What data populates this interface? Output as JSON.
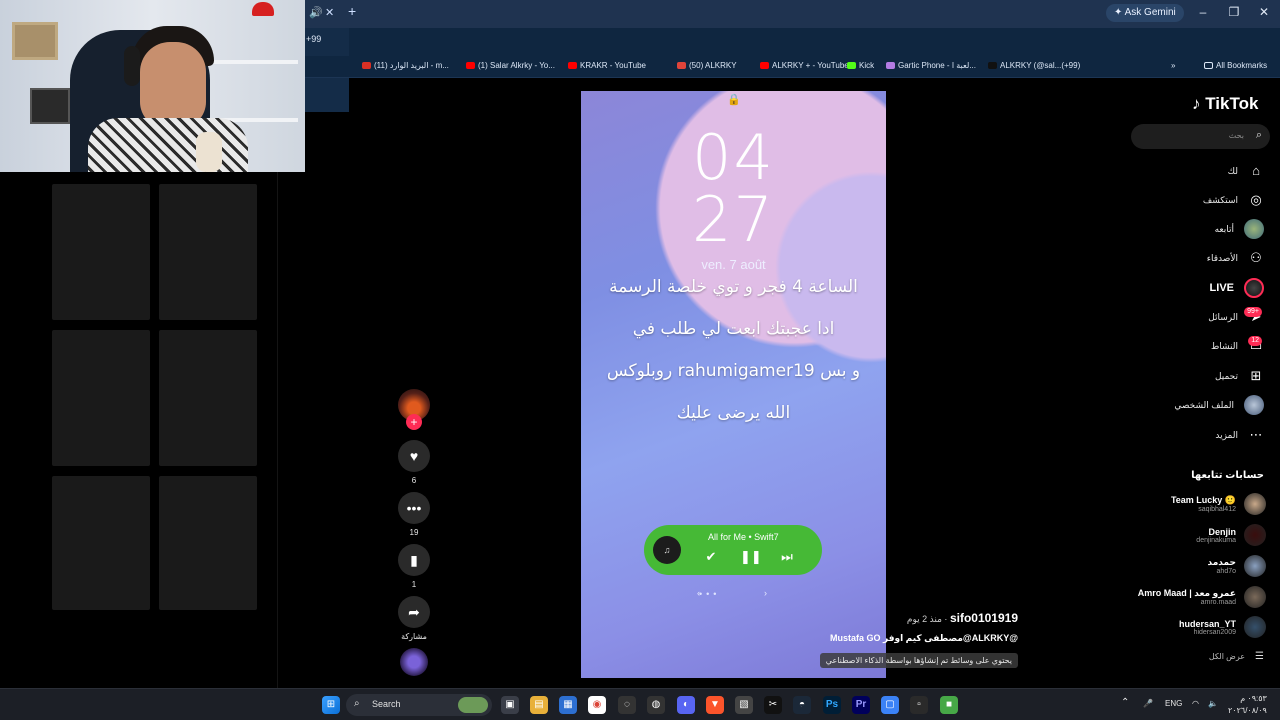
{
  "browser": {
    "gemini_label": "Ask Gemini",
    "badge_tab": "+99",
    "url_fragment": "772",
    "bookmarks": [
      {
        "label": "البريد الوارد (11) - m...",
        "color": "#d93025"
      },
      {
        "label": "(1) Salar Alkrky - Yo...",
        "color": "#ff0000"
      },
      {
        "label": "KRAKR - YouTube",
        "color": "#ff0000"
      },
      {
        "label": "(50) ALKRKY",
        "color": "#e0443a"
      },
      {
        "label": "ALKRKY + - YouTube",
        "color": "#ff0000"
      },
      {
        "label": "Kick",
        "color": "#53fc18"
      },
      {
        "label": "Gartic Phone - لعبة ا...",
        "color": "#b37be3"
      },
      {
        "label": "ALKRKY (@sal...(+99)",
        "color": "#111111"
      }
    ],
    "all_bookmarks": "All Bookmarks"
  },
  "video": {
    "hour": "04",
    "minute": "27",
    "date": "ven. 7 août",
    "caption_lines": [
      "الساعة 4 فجر و توي خلصة الرسمة",
      "ادا عجبتك ابعت لي طلب في",
      "روبلوكس rahumigamer19 و بس",
      "الله يرضى عليك"
    ],
    "player": {
      "title": "All for Me • Swift7"
    }
  },
  "actions": {
    "likes": "6",
    "comments": "19",
    "saves": "1",
    "share_label": "مشاركة"
  },
  "post": {
    "author": "sifo0101919",
    "time": " · منذ 2 يوم",
    "description": "@ALKRKY@مصطفى كيم اوفر Mustafa GO",
    "ai_notice": "يحتوي على وسائط تم إنشاؤها بواسطة الذكاء الاصطناعي"
  },
  "sidebar": {
    "logo": "TikTok",
    "search_placeholder": "بحث",
    "nav": {
      "foryou": "لك",
      "explore": "استكشف",
      "following": "أتابعه",
      "friends": "الأصدقاء",
      "live": "LIVE",
      "messages": "الرسائل",
      "messages_badge": "99+",
      "activity": "النشاط",
      "activity_badge": "12",
      "upload": "تحميل",
      "profile": "الملف الشخصي",
      "more": "المزيد"
    },
    "following_title": "حسابات تتابعها",
    "accounts": [
      {
        "name": "Team Lucky 🙂",
        "user": "saqibhal412"
      },
      {
        "name": "Denjin",
        "user": "denjinakuma"
      },
      {
        "name": "حمدمد",
        "user": "ahd7o"
      },
      {
        "name": "Amro Maad | عمرو معد",
        "user": "amro.maad"
      },
      {
        "name": "hudersan_YT",
        "user": "hidersan2009"
      }
    ],
    "see_all": "عرض الكل"
  },
  "taskbar": {
    "search_label": "Search",
    "lang": "ENG",
    "time": "٠٩:٥٣ م",
    "date": "٢٠٢٦/٠٨/٠٩"
  }
}
